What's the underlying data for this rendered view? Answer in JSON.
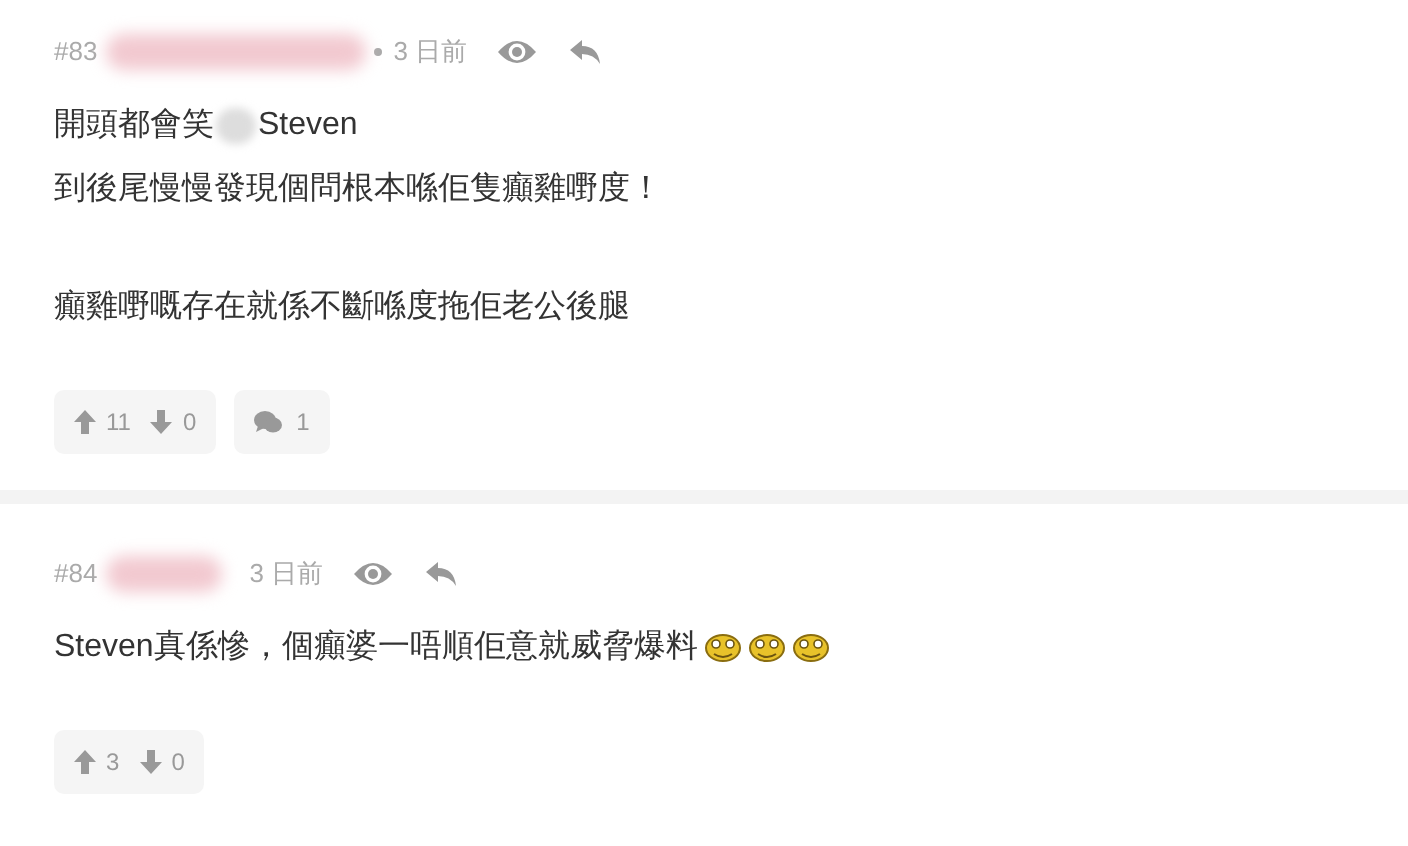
{
  "comments": [
    {
      "number": "#83",
      "author_redacted": true,
      "separator_dot": true,
      "time": "3 日前",
      "paragraphs": [
        [
          [
            {
              "kind": "text",
              "text": "開頭都會笑"
            },
            {
              "kind": "blur"
            },
            {
              "kind": "text",
              "text": "Steven"
            }
          ],
          [
            {
              "kind": "text",
              "text": "到後尾慢慢發現個問根本喺佢隻癲雞嘢度！"
            }
          ]
        ],
        [
          [
            {
              "kind": "text",
              "text": "癲雞嘢嘅存在就係不斷喺度拖佢老公後腿"
            }
          ]
        ]
      ],
      "upvotes": "11",
      "downvotes": "0",
      "replies": "1"
    },
    {
      "number": "#84",
      "author_redacted": true,
      "separator_dot": false,
      "time": "3 日前",
      "paragraphs": [
        [
          [
            {
              "kind": "text",
              "text": "Steven真係慘，個癲婆一唔順佢意就威脅爆料"
            },
            {
              "kind": "emoticon"
            },
            {
              "kind": "emoticon"
            },
            {
              "kind": "emoticon"
            }
          ]
        ]
      ],
      "upvotes": "3",
      "downvotes": "0"
    }
  ]
}
